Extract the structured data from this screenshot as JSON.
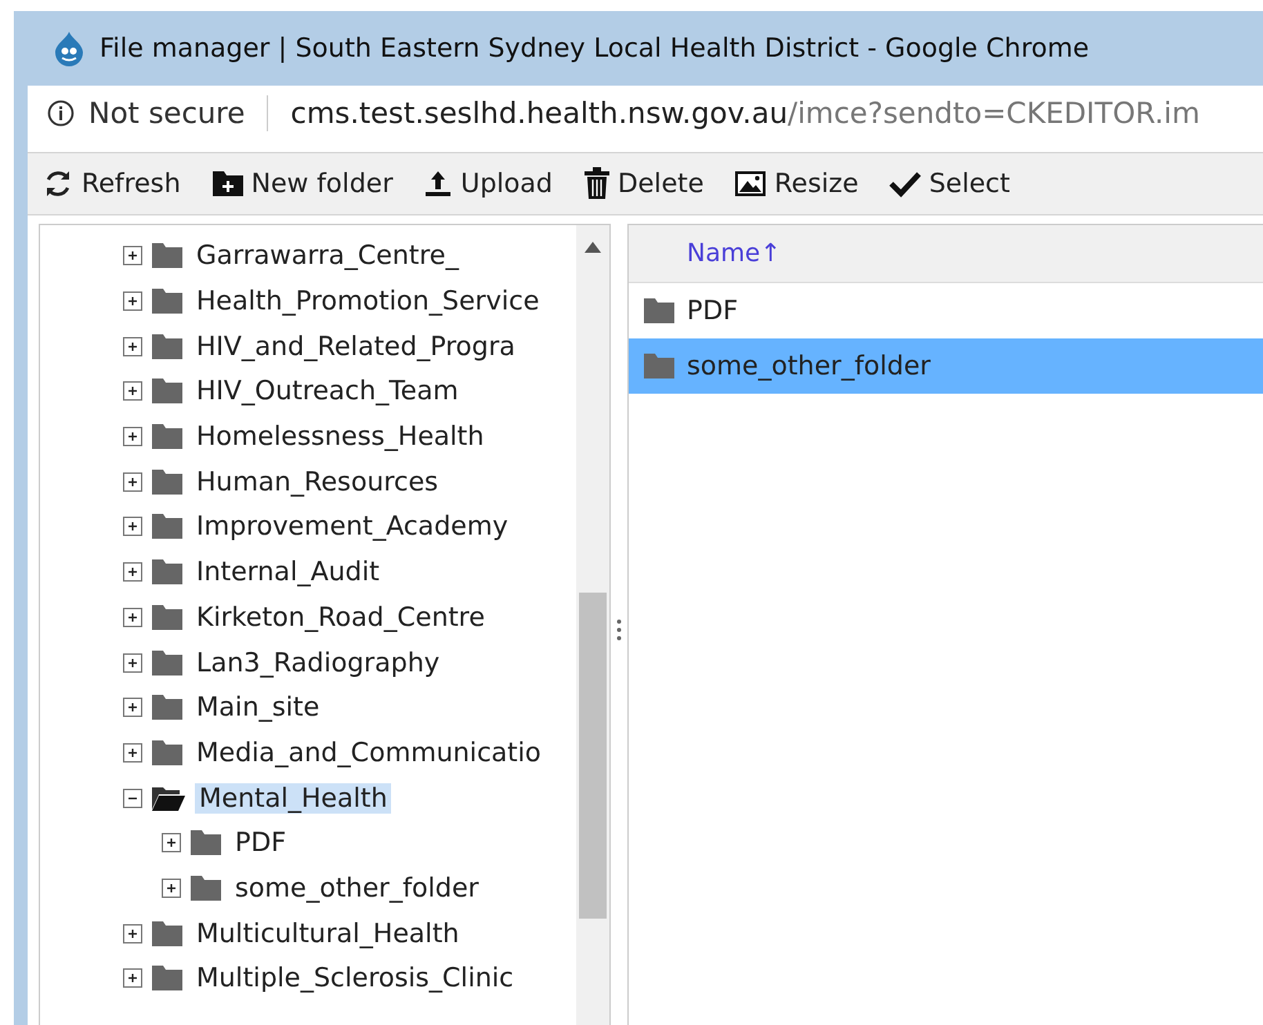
{
  "window": {
    "title": "File manager | South Eastern Sydney Local Health District - Google Chrome"
  },
  "address_bar": {
    "security": "Not secure",
    "host": "cms.test.seslhd.health.nsw.gov.au",
    "path": "/imce?sendto=CKEDITOR.im"
  },
  "toolbar": [
    {
      "kind": "refresh",
      "label": "Refresh"
    },
    {
      "kind": "new-folder",
      "label": "New folder"
    },
    {
      "kind": "upload",
      "label": "Upload"
    },
    {
      "kind": "delete",
      "label": "Delete"
    },
    {
      "kind": "resize",
      "label": "Resize"
    },
    {
      "kind": "select",
      "label": "Select"
    }
  ],
  "tree": [
    {
      "name": "Garrawarra_Centre_",
      "expanded": false,
      "selected": false
    },
    {
      "name": "Health_Promotion_Service",
      "expanded": false,
      "selected": false
    },
    {
      "name": "HIV_and_Related_Progra",
      "expanded": false,
      "selected": false
    },
    {
      "name": "HIV_Outreach_Team",
      "expanded": false,
      "selected": false
    },
    {
      "name": "Homelessness_Health",
      "expanded": false,
      "selected": false
    },
    {
      "name": "Human_Resources",
      "expanded": false,
      "selected": false
    },
    {
      "name": "Improvement_Academy",
      "expanded": false,
      "selected": false
    },
    {
      "name": "Internal_Audit",
      "expanded": false,
      "selected": false
    },
    {
      "name": "Kirketon_Road_Centre",
      "expanded": false,
      "selected": false
    },
    {
      "name": "Lan3_Radiography",
      "expanded": false,
      "selected": false
    },
    {
      "name": "Main_site",
      "expanded": false,
      "selected": false
    },
    {
      "name": "Media_and_Communicatio",
      "expanded": false,
      "selected": false
    },
    {
      "name": "Mental_Health",
      "expanded": true,
      "selected": true,
      "children": [
        {
          "name": "PDF",
          "expanded": false,
          "selected": false
        },
        {
          "name": "some_other_folder",
          "expanded": false,
          "selected": false
        }
      ]
    },
    {
      "name": "Multicultural_Health",
      "expanded": false,
      "selected": false
    },
    {
      "name": "Multiple_Sclerosis_Clinic",
      "expanded": false,
      "selected": false
    }
  ],
  "file_list": {
    "columns": [
      "Name↑"
    ],
    "rows": [
      {
        "name": "PDF",
        "selected": false
      },
      {
        "name": "some_other_folder",
        "selected": true
      }
    ]
  }
}
